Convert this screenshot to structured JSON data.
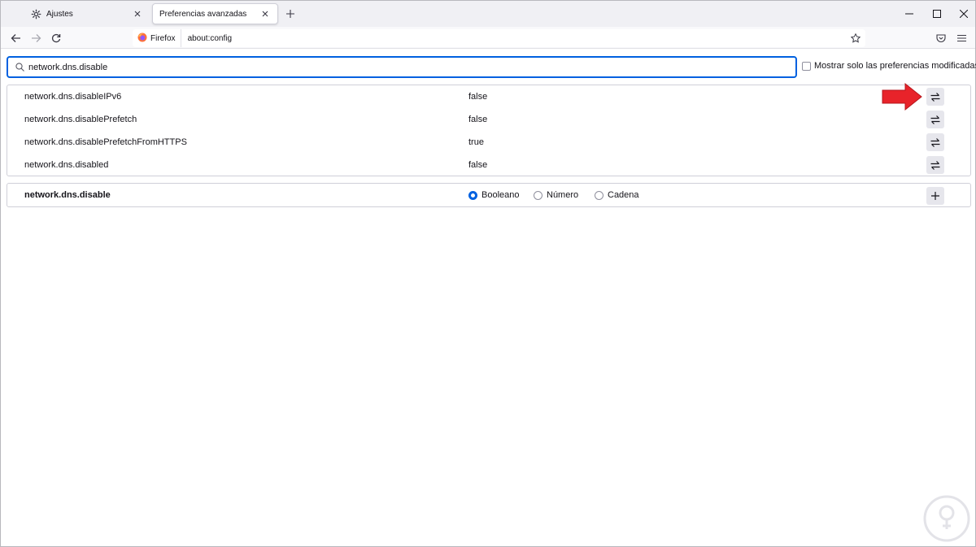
{
  "tabs": [
    {
      "label": "Ajustes",
      "icon": "gear-icon",
      "active": false
    },
    {
      "label": "Preferencias avanzadas",
      "icon": "",
      "active": true
    }
  ],
  "navbar": {
    "identity_label": "Firefox",
    "url": "about:config"
  },
  "search": {
    "value": "network.dns.disable",
    "modified_only_label": "Mostrar solo las preferencias modificadas",
    "modified_only_checked": false
  },
  "preferences": [
    {
      "name": "network.dns.disableIPv6",
      "value": "false"
    },
    {
      "name": "network.dns.disablePrefetch",
      "value": "false"
    },
    {
      "name": "network.dns.disablePrefetchFromHTTPS",
      "value": "true"
    },
    {
      "name": "network.dns.disabled",
      "value": "false"
    }
  ],
  "new_pref": {
    "name": "network.dns.disable",
    "types": [
      {
        "label": "Booleano",
        "checked": true
      },
      {
        "label": "Número",
        "checked": false
      },
      {
        "label": "Cadena",
        "checked": false
      }
    ]
  },
  "colors": {
    "accent": "#0061e0",
    "arrow": "#e8232a"
  }
}
